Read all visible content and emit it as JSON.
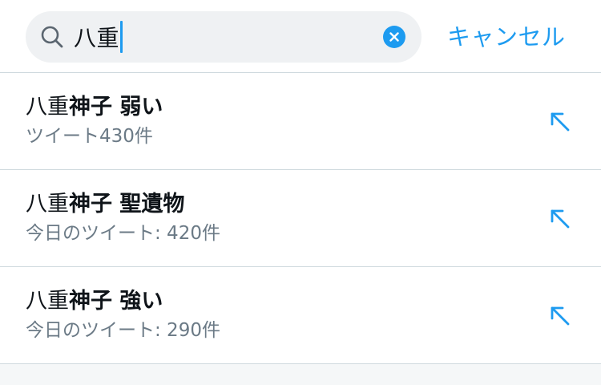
{
  "search": {
    "query": "八重",
    "clear_icon": "close-circle-icon",
    "cancel_label": "キャンセル"
  },
  "colors": {
    "accent": "#1d9bf0",
    "search_background": "#eff1f3",
    "primary_text": "#0f1419",
    "secondary_text": "#6b7a86",
    "divider": "#cfd9de"
  },
  "suggestions": [
    {
      "match": "八重",
      "rest": "神子 弱い",
      "subtitle": "ツイート430件",
      "icon": "arrow-up-left-icon"
    },
    {
      "match": "八重",
      "rest": "神子 聖遺物",
      "subtitle": "今日のツイート: 420件",
      "icon": "arrow-up-left-icon"
    },
    {
      "match": "八重",
      "rest": "神子 強い",
      "subtitle": "今日のツイート: 290件",
      "icon": "arrow-up-left-icon"
    }
  ]
}
